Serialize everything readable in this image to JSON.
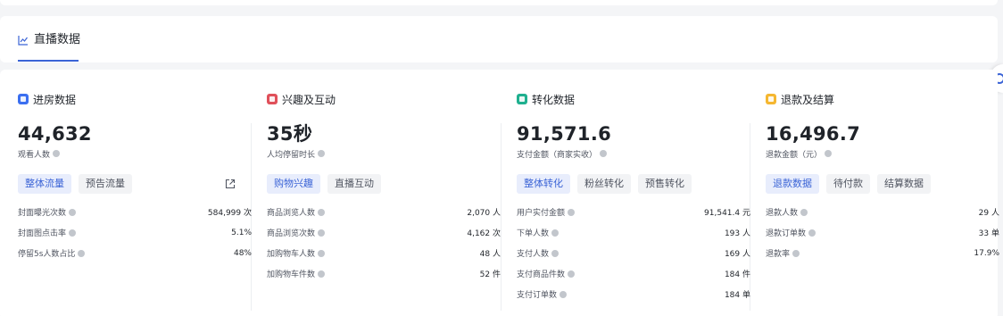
{
  "tab": {
    "label": "直播数据"
  },
  "colors": {
    "accent": "#3b64d6",
    "room": "#3b6ff0",
    "interest": "#e0505a",
    "conversion": "#1fb08f",
    "refund": "#f5b731"
  },
  "sections": [
    {
      "title": "进房数据",
      "icon": "user-card-icon",
      "value": "44,632",
      "label": "观看人数",
      "tabs": [
        "整体流量",
        "预告流量"
      ],
      "rows": [
        {
          "label": "封面曝光次数",
          "value": "584,999 次"
        },
        {
          "label": "封面图点击率",
          "value": "5.1%"
        },
        {
          "label": "停留5s人数占比",
          "value": "48%"
        }
      ]
    },
    {
      "title": "兴趣及互动",
      "icon": "interaction-icon",
      "value": "35秒",
      "label": "人均停留时长",
      "tabs": [
        "购物兴趣",
        "直播互动"
      ],
      "rows": [
        {
          "label": "商品浏览人数",
          "value": "2,070 人"
        },
        {
          "label": "商品浏览次数",
          "value": "4,162 次"
        },
        {
          "label": "加购物车人数",
          "value": "48 人"
        },
        {
          "label": "加购物车件数",
          "value": "52 件"
        }
      ]
    },
    {
      "title": "转化数据",
      "icon": "funnel-icon",
      "value": "91,571.6",
      "label": "支付金额（商家实收）",
      "tabs": [
        "整体转化",
        "粉丝转化",
        "预售转化"
      ],
      "rows": [
        {
          "label": "用户实付金额",
          "value": "91,541.4 元"
        },
        {
          "label": "下单人数",
          "value": "193 人"
        },
        {
          "label": "支付人数",
          "value": "169 人"
        },
        {
          "label": "支付商品件数",
          "value": "184 件"
        },
        {
          "label": "支付订单数",
          "value": "184 单"
        }
      ]
    },
    {
      "title": "退款及结算",
      "icon": "refund-icon",
      "value": "16,496.7",
      "label": "退款金额（元）",
      "tabs": [
        "退款数据",
        "待付款",
        "结算数据"
      ],
      "rows": [
        {
          "label": "退款人数",
          "value": "29 人"
        },
        {
          "label": "退款订单数",
          "value": "33 单"
        },
        {
          "label": "退款率",
          "value": "17.9%"
        }
      ]
    }
  ]
}
